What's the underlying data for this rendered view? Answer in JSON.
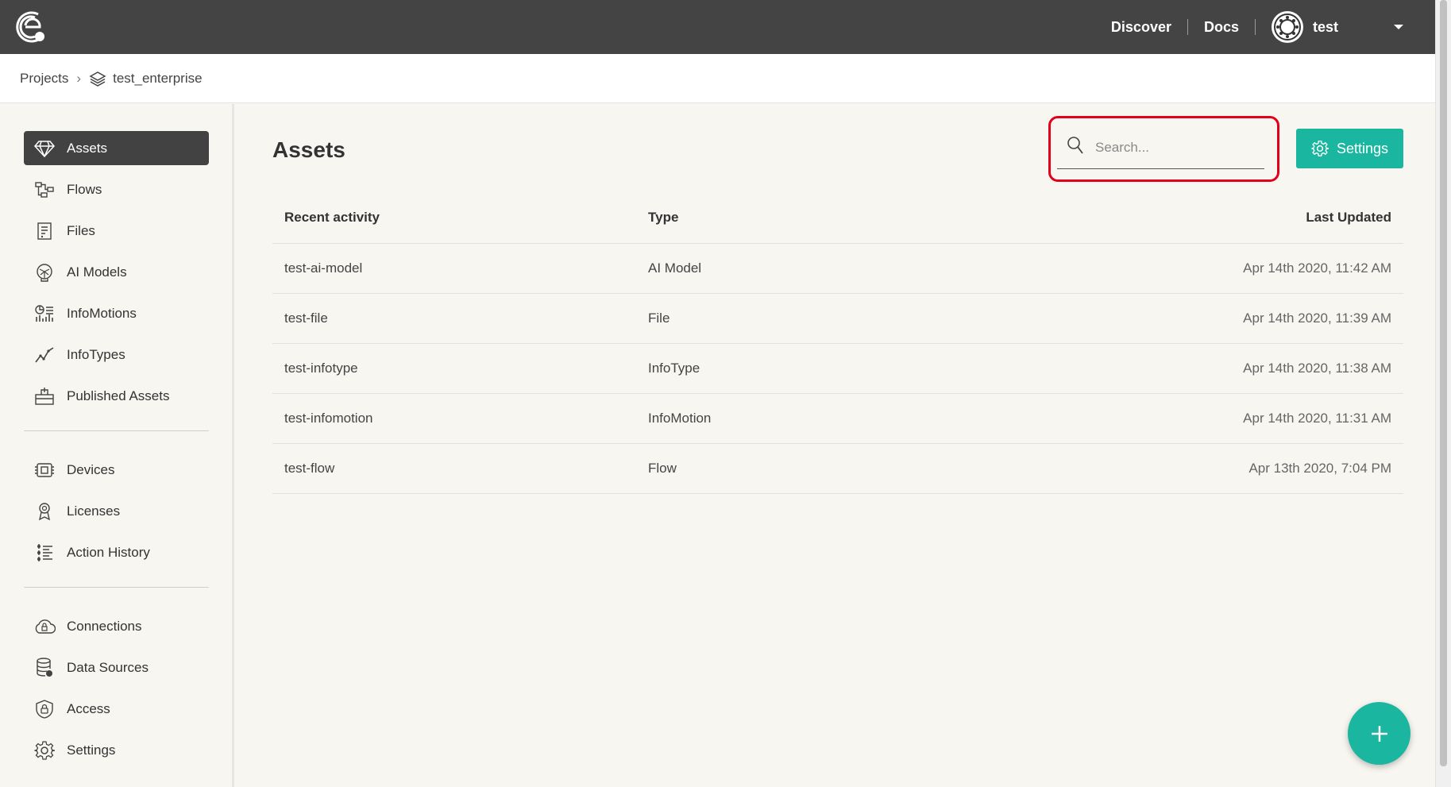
{
  "topbar": {
    "discover": "Discover",
    "docs": "Docs",
    "username": "test"
  },
  "breadcrumb": {
    "root": "Projects",
    "separator": "›",
    "project": "test_enterprise"
  },
  "sidebar": {
    "items": [
      {
        "label": "Assets",
        "icon": "diamond-icon",
        "active": true
      },
      {
        "label": "Flows",
        "icon": "flow-icon"
      },
      {
        "label": "Files",
        "icon": "file-icon"
      },
      {
        "label": "AI Models",
        "icon": "brain-icon"
      },
      {
        "label": "InfoMotions",
        "icon": "infomotion-icon"
      },
      {
        "label": "InfoTypes",
        "icon": "trend-icon"
      },
      {
        "label": "Published Assets",
        "icon": "publish-icon"
      },
      {
        "label": "Devices",
        "icon": "chip-icon"
      },
      {
        "label": "Licenses",
        "icon": "license-icon"
      },
      {
        "label": "Action History",
        "icon": "history-icon"
      },
      {
        "label": "Connections",
        "icon": "cloud-icon"
      },
      {
        "label": "Data Sources",
        "icon": "database-icon"
      },
      {
        "label": "Access",
        "icon": "shield-lock-icon"
      },
      {
        "label": "Settings",
        "icon": "gear-icon"
      }
    ]
  },
  "main": {
    "title": "Assets",
    "search_placeholder": "Search...",
    "settings_label": "Settings",
    "columns": [
      "Recent activity",
      "Type",
      "Last Updated"
    ],
    "rows": [
      {
        "name": "test-ai-model",
        "type": "AI Model",
        "updated": "Apr 14th 2020, 11:42 AM"
      },
      {
        "name": "test-file",
        "type": "File",
        "updated": "Apr 14th 2020, 11:39 AM"
      },
      {
        "name": "test-infotype",
        "type": "InfoType",
        "updated": "Apr 14th 2020, 11:38 AM"
      },
      {
        "name": "test-infomotion",
        "type": "InfoMotion",
        "updated": "Apr 14th 2020, 11:31 AM"
      },
      {
        "name": "test-flow",
        "type": "Flow",
        "updated": "Apr 13th 2020, 7:04 PM"
      }
    ]
  },
  "colors": {
    "topbar": "#444444",
    "accent": "#1bb6a0",
    "highlight": "#e2001a",
    "background": "#f7f6f1"
  }
}
